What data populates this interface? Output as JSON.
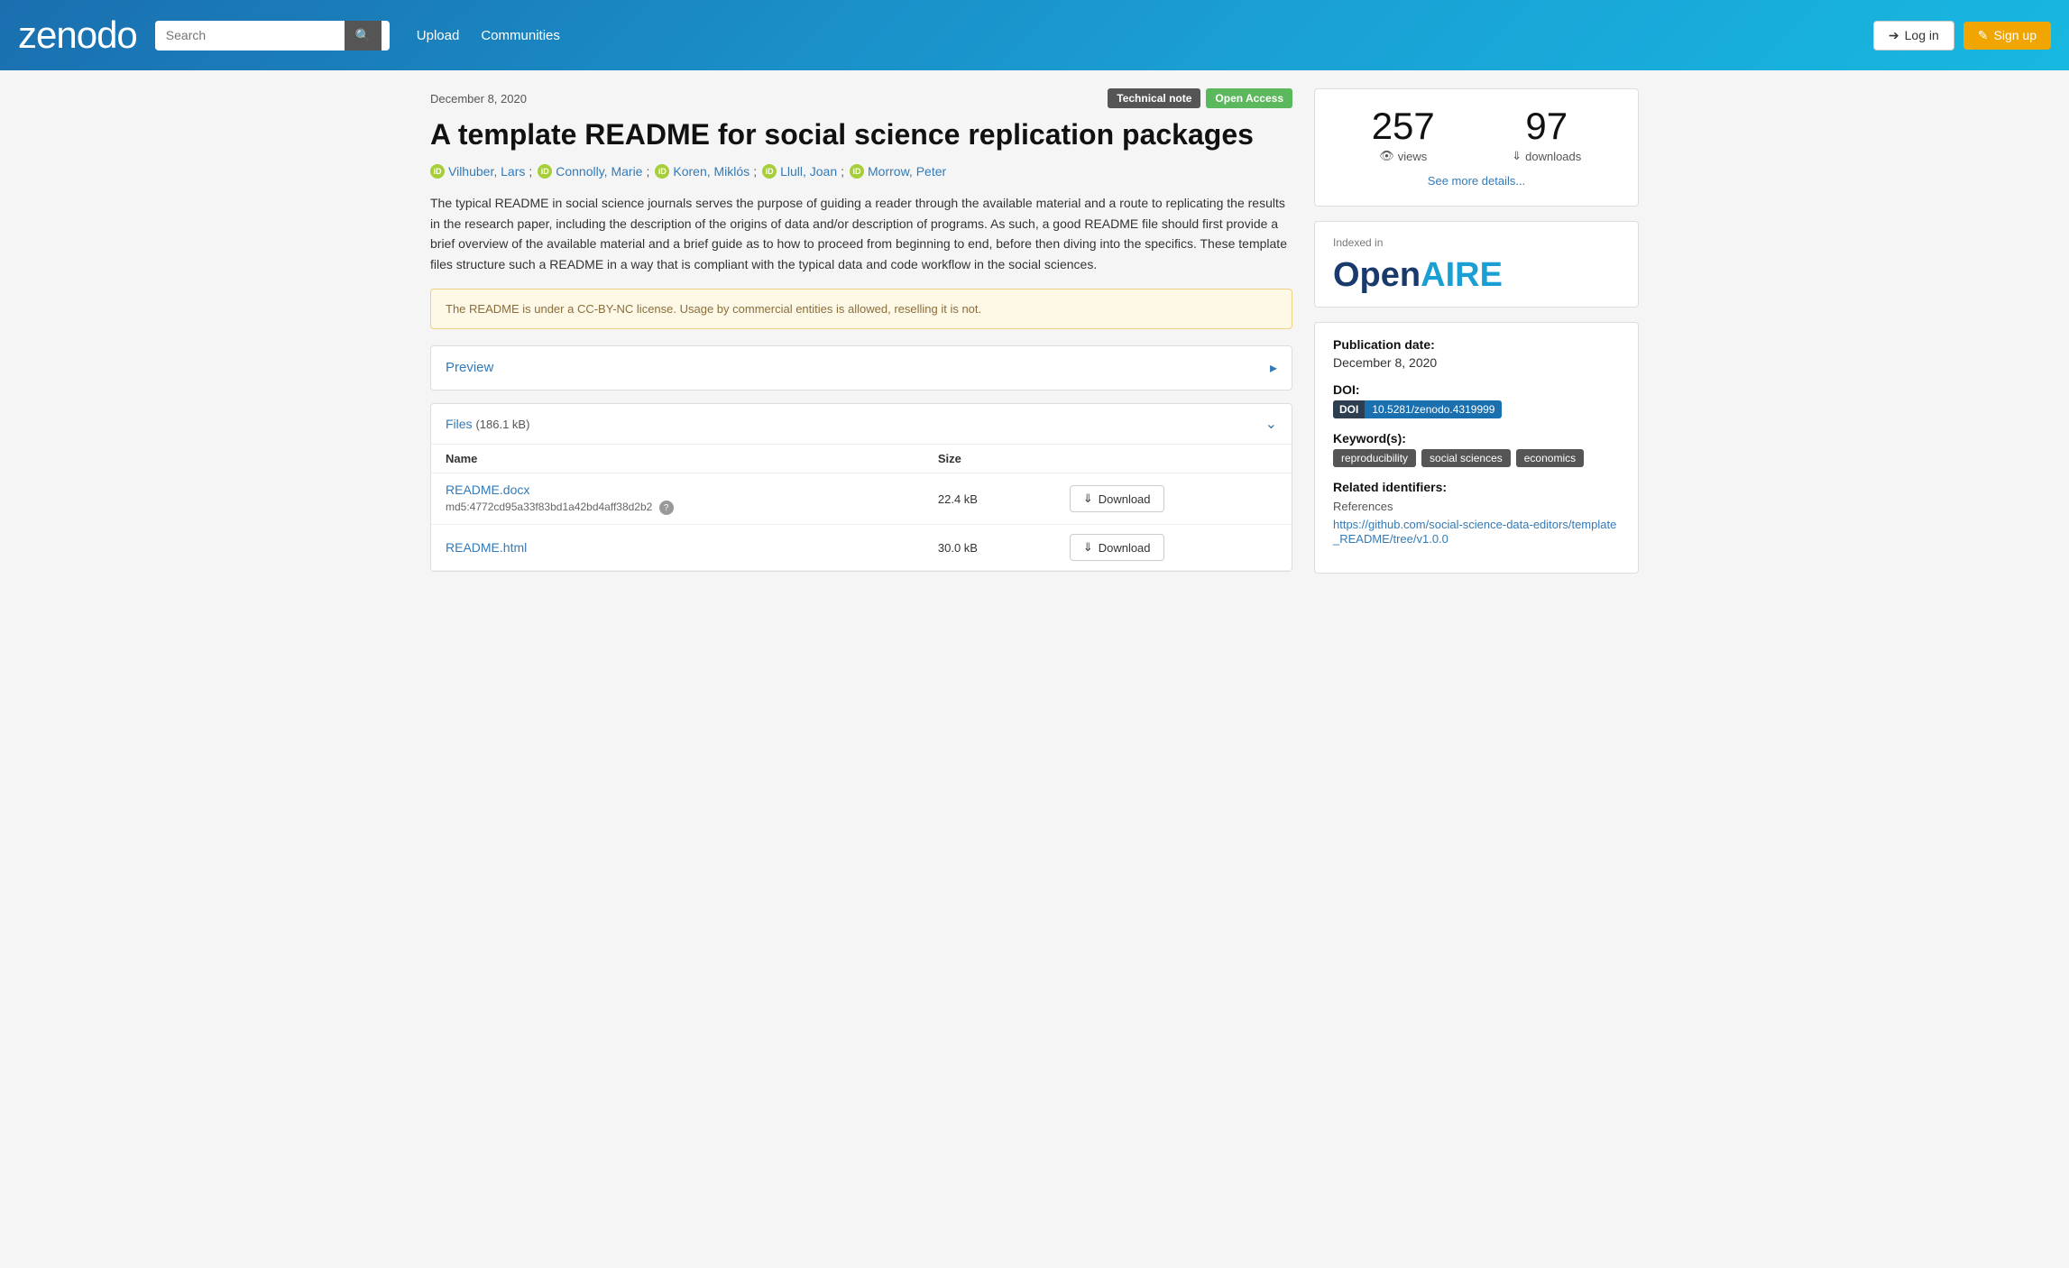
{
  "header": {
    "logo": "zenodo",
    "search_placeholder": "Search",
    "nav": [
      {
        "label": "Upload",
        "href": "#"
      },
      {
        "label": "Communities",
        "href": "#"
      }
    ],
    "login_label": "Log in",
    "signup_label": "Sign up"
  },
  "article": {
    "date": "December 8, 2020",
    "badges": [
      {
        "label": "Technical note",
        "type": "technical"
      },
      {
        "label": "Open Access",
        "type": "open"
      }
    ],
    "title": "A template README for social science replication packages",
    "authors": [
      {
        "name": "Vilhuber, Lars",
        "sep": ";"
      },
      {
        "name": "Connolly, Marie",
        "sep": ";"
      },
      {
        "name": "Koren, Miklós",
        "sep": ";"
      },
      {
        "name": "Llull, Joan",
        "sep": ";"
      },
      {
        "name": "Morrow, Peter",
        "sep": ""
      }
    ],
    "description": "The typical README in social science journals serves the purpose of guiding a reader through the available material and a route to replicating the results in the research paper, including the description of the origins of data and/or description of programs. As such, a good README file should first provide a brief overview of the available material and a brief guide as to how to proceed from beginning to end, before then diving into the specifics. These template files structure such a README in a way that is compliant with the typical data and code workflow in the social sciences.",
    "notice": "The README is under a CC-BY-NC license. Usage by commercial entities is allowed, reselling it is not.",
    "preview_label": "Preview",
    "files_label": "Files",
    "files_size": "(186.1 kB)",
    "files_columns": [
      "Name",
      "Size"
    ],
    "files": [
      {
        "name": "README.docx",
        "size": "22.4 kB",
        "hash": "md5:4772cd95a33f83bd1a42bd4aff38d2b2",
        "download_label": "Download"
      },
      {
        "name": "README.html",
        "size": "30.0 kB",
        "hash": "",
        "download_label": "Download"
      }
    ]
  },
  "sidebar": {
    "views_count": "257",
    "views_label": "views",
    "downloads_count": "97",
    "downloads_label": "downloads",
    "see_more_label": "See more details...",
    "indexed_label": "Indexed in",
    "openaire_open": "Open",
    "openaire_aire": "AIRE",
    "publication_date_label": "Publication date:",
    "publication_date": "December 8, 2020",
    "doi_label": "DOI:",
    "doi_badge_label": "DOI",
    "doi_value": "10.5281/zenodo.4319999",
    "keywords_label": "Keyword(s):",
    "keywords": [
      "reproducibility",
      "social sciences",
      "economics"
    ],
    "related_label": "Related identifiers:",
    "related_type": "References",
    "related_url": "https://github.com/social-science-data-editors/template_README/tree/v1.0.0"
  }
}
